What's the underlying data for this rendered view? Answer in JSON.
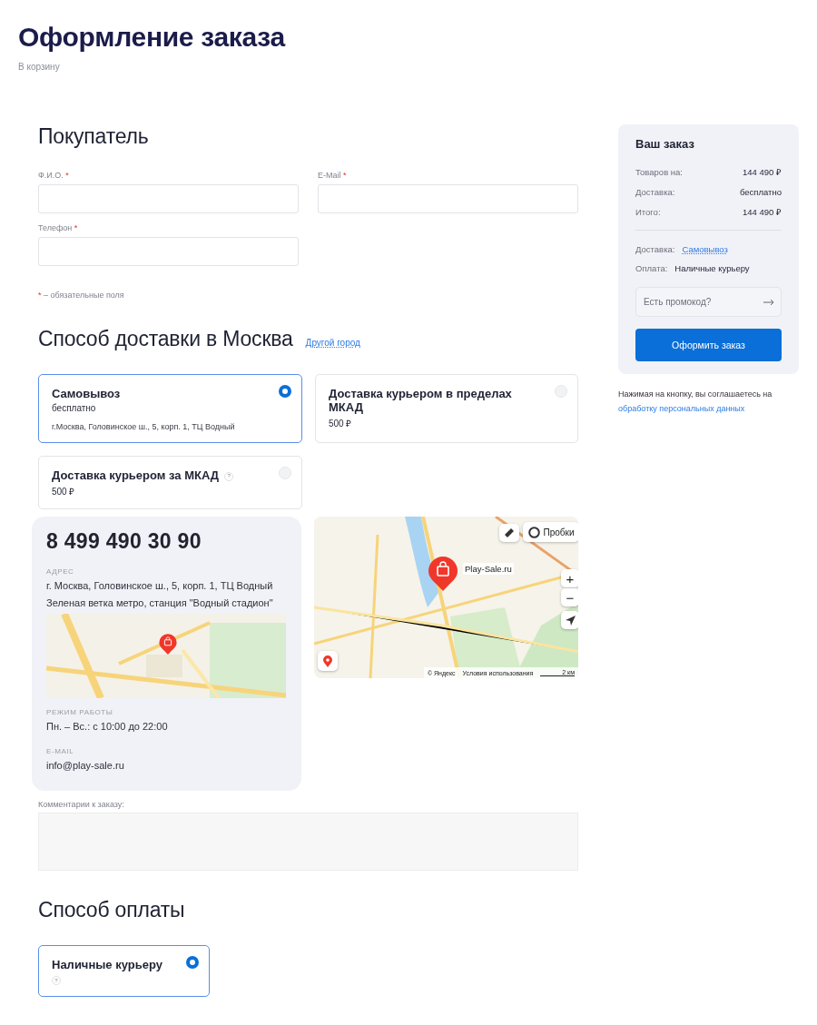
{
  "page": {
    "title": "Оформление заказа",
    "back_link": "В корзину"
  },
  "buyer": {
    "heading": "Покупатель",
    "fields": [
      {
        "label": "Ф.И.О.",
        "mark": "*"
      },
      {
        "label": "E-Mail",
        "mark": "*"
      },
      {
        "label": "Телефон",
        "mark": "*"
      }
    ],
    "note": {
      "mark": "*",
      "text": "– обязательные поля"
    }
  },
  "delivery": {
    "heading": "Способ доставки в Москва",
    "city_link": "Другой город",
    "options": [
      {
        "title": "Самовывоз",
        "price": "бесплатно",
        "address": "г.Москва, Головинское ш., 5, корп. 1, ТЦ Водный",
        "help": false,
        "selected": true
      },
      {
        "title": "Доставка курьером в пределах МКАД",
        "price": "500 ₽",
        "help": false,
        "selected": false
      },
      {
        "title": "Доставка курьером за МКАД",
        "price": "500 ₽",
        "help": true,
        "help_mark": "?",
        "selected": false
      }
    ]
  },
  "pickup_point": {
    "phone": "8 499 490 30 90",
    "sections": [
      {
        "label": "АДРЕС",
        "lines": [
          "г. Москва, Головинское ш., 5, корп. 1, ТЦ Водный",
          "Зеленая ветка метро, станция \"Водный стадион\""
        ],
        "map": true
      },
      {
        "label": "РЕЖИМ РАБОТЫ",
        "lines": [
          "Пн. – Вс.: с 10:00 до 22:00"
        ],
        "map": false
      },
      {
        "label": "E-MAIL",
        "lines": [
          "info@play-sale.ru"
        ],
        "map": false
      }
    ]
  },
  "map": {
    "traffic_button": "Пробки",
    "place_label": "Play-Sale.ru",
    "zoom_in": "+",
    "zoom_out": "−",
    "copyright": "© Яндекс",
    "terms_link": "Условия использования",
    "scale": "2 км"
  },
  "comment": {
    "label": "Комментарии к заказу:"
  },
  "payment": {
    "heading": "Способ оплаты",
    "options": [
      {
        "title": "Наличные курьеру",
        "help": true,
        "help_mark": "?",
        "selected": true
      }
    ]
  },
  "summary": {
    "heading": "Ваш заказ",
    "rows": [
      {
        "label": "Товаров на:",
        "value": "144 490 ₽"
      },
      {
        "label": "Доставка:",
        "value": "бесплатно"
      },
      {
        "label": "Итого:",
        "value": "144 490 ₽"
      }
    ],
    "delivery": {
      "label": "Доставка:",
      "value": "Самовывоз"
    },
    "payment": {
      "label": "Оплата:",
      "value": "Наличные курьеру"
    },
    "promo": {
      "placeholder": "Есть промокод?"
    },
    "submit": "Оформить заказ",
    "consent": {
      "text": "Нажимая на кнопку, вы соглашаетесь на",
      "link": "обработку персональных данных"
    }
  }
}
